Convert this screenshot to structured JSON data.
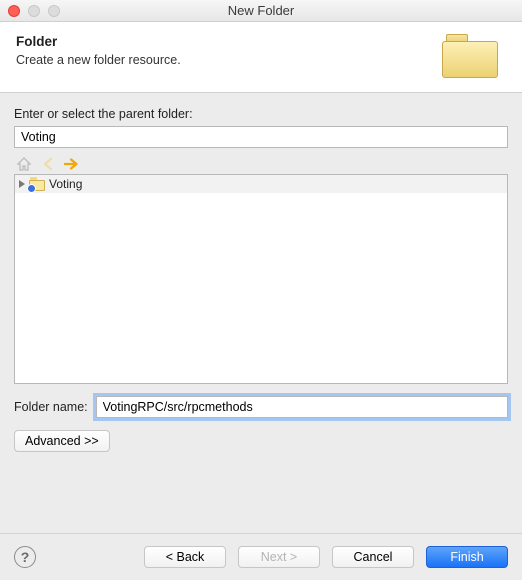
{
  "window": {
    "title": "New Folder"
  },
  "header": {
    "heading": "Folder",
    "description": "Create a new folder resource."
  },
  "parent": {
    "label": "Enter or select the parent folder:",
    "value": "Voting"
  },
  "nav": {
    "home_icon": "home-icon",
    "back_icon": "arrow-left-icon",
    "forward_icon": "arrow-right-icon"
  },
  "tree": {
    "items": [
      {
        "label": "Voting",
        "expandable": true
      }
    ]
  },
  "folder_name": {
    "label": "Folder name:",
    "value": "VotingRPC/src/rpcmethods"
  },
  "advanced": {
    "label": "Advanced >>"
  },
  "footer": {
    "back": "< Back",
    "next": "Next >",
    "cancel": "Cancel",
    "finish": "Finish"
  }
}
